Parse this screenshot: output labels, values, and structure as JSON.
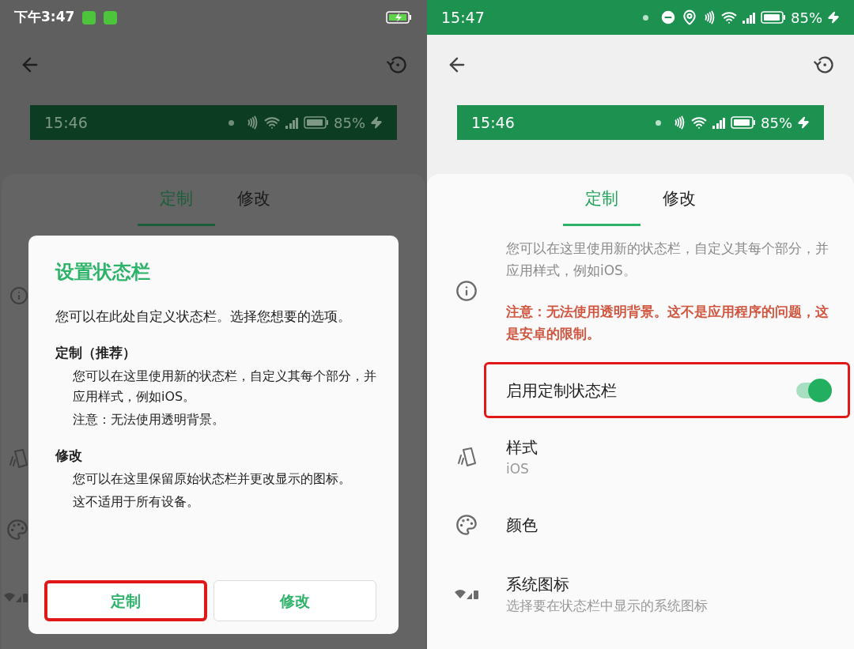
{
  "left_screen": {
    "status_bar": {
      "time": "下午3:47"
    },
    "preview_bar": {
      "time": "15:46",
      "battery": "85%"
    },
    "tabs": [
      {
        "label": "定制",
        "selected": true
      },
      {
        "label": "修改",
        "selected": false
      }
    ],
    "dialog": {
      "title": "设置状态栏",
      "intro": "您可以在此处自定义状态栏。选择您想要的选项。",
      "sections": [
        {
          "heading": "定制（推荐）",
          "lines": [
            "您可以在这里使用新的状态栏，自定义其每个部分，并应用样式，例如iOS。",
            "注意：无法使用透明背景。"
          ]
        },
        {
          "heading": "修改",
          "lines": [
            "您可以在这里保留原始状态栏并更改显示的图标。",
            "这不适用于所有设备。"
          ]
        }
      ],
      "buttons": [
        {
          "label": "定制",
          "highlighted": true
        },
        {
          "label": "修改",
          "highlighted": false
        }
      ]
    }
  },
  "right_screen": {
    "status_bar": {
      "time": "15:47",
      "battery": "85%"
    },
    "preview_bar": {
      "time": "15:46",
      "battery": "85%"
    },
    "tabs": [
      {
        "label": "定制",
        "selected": true
      },
      {
        "label": "修改",
        "selected": false
      }
    ],
    "info": {
      "text": "您可以在这里使用新的状态栏，自定义其每个部分，并应用样式，例如iOS。",
      "warning": "注意：无法使用透明背景。这不是应用程序的问题，这是安卓的限制。"
    },
    "toggle_row": {
      "label": "启用定制状态栏",
      "on": true,
      "highlighted": true
    },
    "settings": [
      {
        "title": "样式",
        "subtitle": "iOS"
      },
      {
        "title": "颜色"
      },
      {
        "title": "系统图标",
        "subtitle": "选择要在状态栏中显示的系统图标"
      }
    ]
  }
}
